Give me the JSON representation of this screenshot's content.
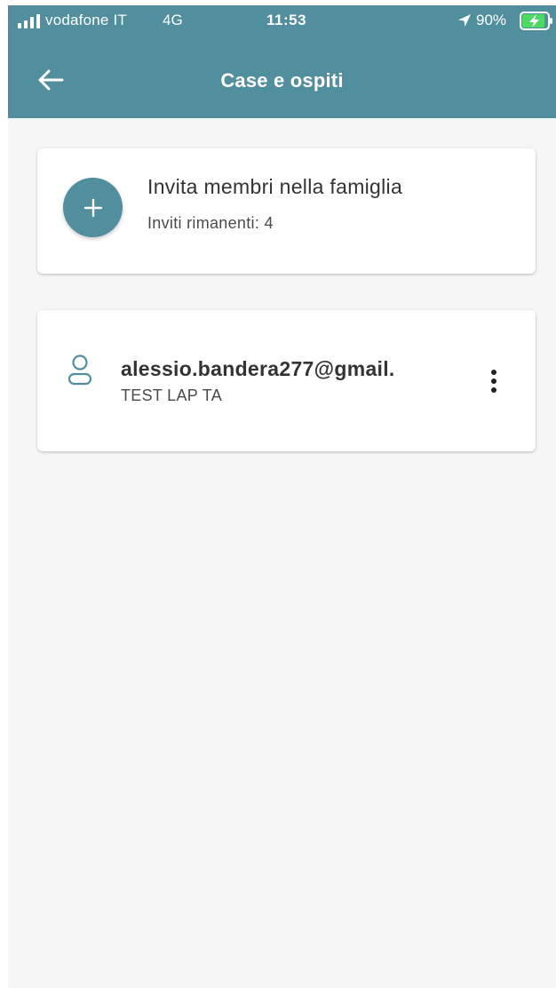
{
  "status_bar": {
    "carrier": "vodafone IT",
    "network": "4G",
    "time": "11:53",
    "battery": "90%",
    "battery_level": 0.9,
    "icons": [
      "signal-bars-icon",
      "location-arrow-icon",
      "battery-charging-icon"
    ]
  },
  "header": {
    "title": "Case e ospiti",
    "back_icon": "arrow-left-icon",
    "background": "#518f9e"
  },
  "invite_card": {
    "title": "Invita membri nella famiglia",
    "subtitle": "Inviti rimanenti: 4",
    "add_icon": "plus-icon"
  },
  "members": [
    {
      "email": "alessio.bandera277@gmail.",
      "home": "TEST LAP TA",
      "icon": "user-icon",
      "menu_icon": "more-vertical-icon"
    }
  ],
  "colors": {
    "accent": "#518f9e",
    "background": "#f6f6f6",
    "card": "#ffffff",
    "text": "#333333"
  }
}
